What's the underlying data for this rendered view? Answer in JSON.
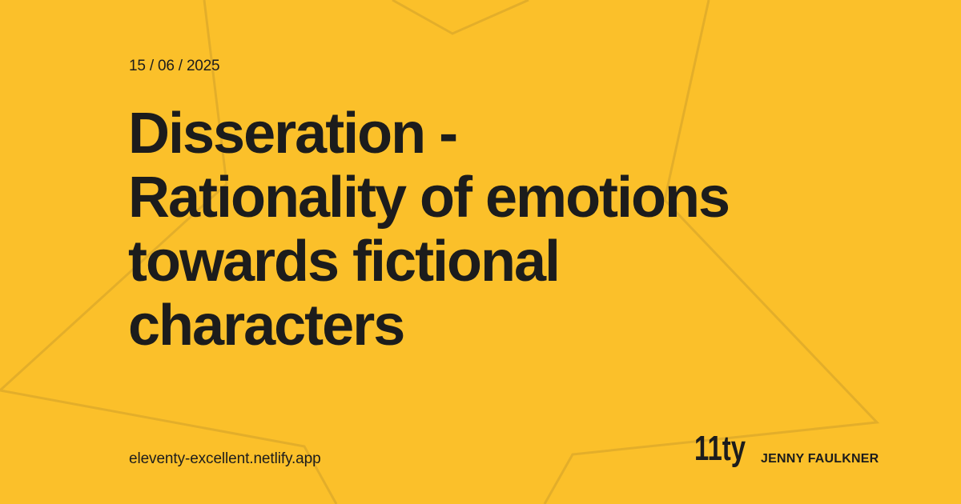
{
  "theme": {
    "background": "#FBC02A",
    "text": "#1C1C1C",
    "shape_stroke": "#E3AE2A"
  },
  "post": {
    "date": "15 / 06 / 2025",
    "title": "Disseration - Rationality of emotions towards fictional characters"
  },
  "footer": {
    "site_url": "eleventy-excellent.netlify.app",
    "logo_text": "11ty",
    "author": "JENNY FAULKNER"
  }
}
